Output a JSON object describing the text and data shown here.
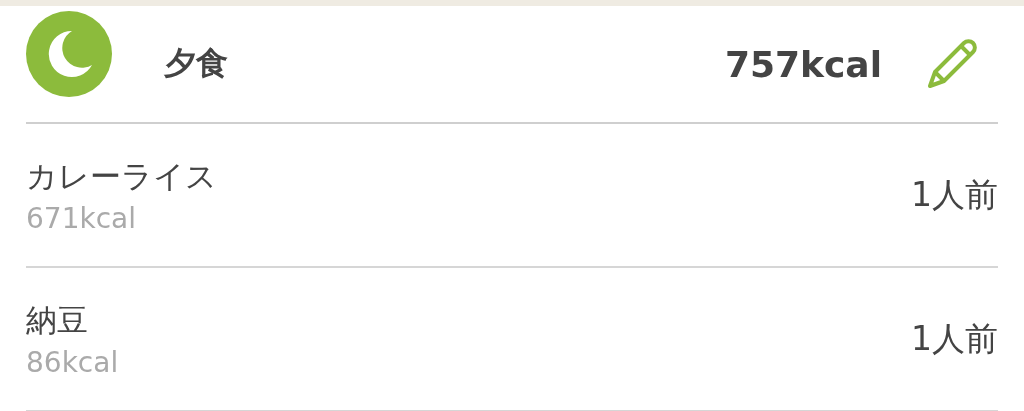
{
  "meal": {
    "title": "夕食",
    "calories": "757kcal"
  },
  "items": [
    {
      "name": "カレーライス",
      "calories": "671kcal",
      "servings": "1人前"
    },
    {
      "name": "納豆",
      "calories": "86kcal",
      "servings": "1人前"
    }
  ]
}
